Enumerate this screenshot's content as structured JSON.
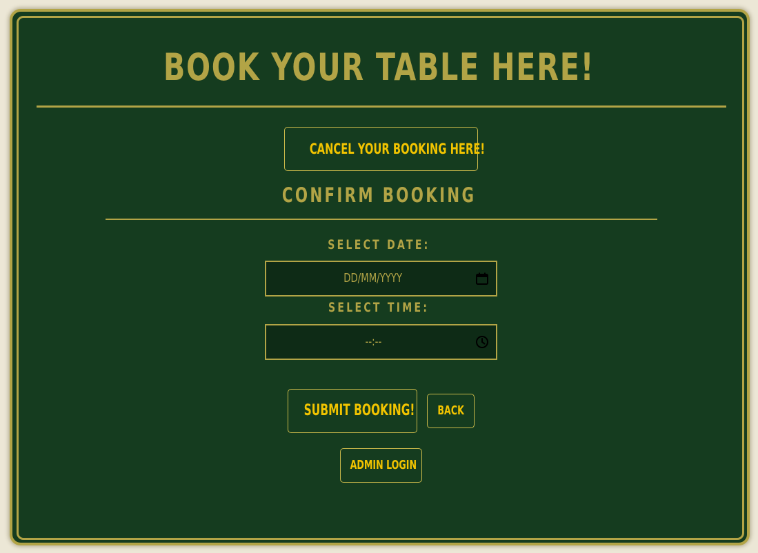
{
  "page": {
    "title": "BOOK YOUR TABLE HERE!"
  },
  "actions": {
    "cancel_label": "CANCEL YOUR BOOKING HERE!",
    "submit_label": "SUBMIT BOOKING!",
    "back_label": "BACK",
    "admin_label": "ADMIN LOGIN"
  },
  "form": {
    "title": "CONFIRM BOOKING",
    "date": {
      "label": "SELECT DATE:",
      "placeholder": "DD/MM/YYYY",
      "icon": "calendar-icon"
    },
    "time": {
      "label": "SELECT TIME:",
      "placeholder": "--:--",
      "icon": "clock-icon"
    }
  },
  "colors": {
    "background": "#153c1f",
    "gold": "#b2a446",
    "button_text": "#f2c400",
    "field_bg": "#0e2b16"
  }
}
